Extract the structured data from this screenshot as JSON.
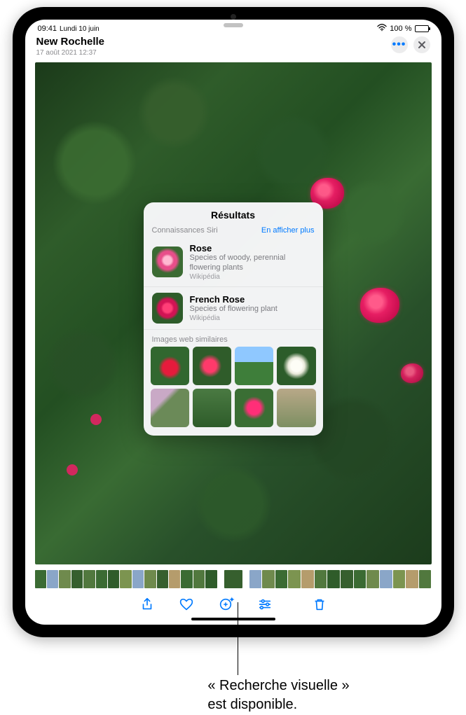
{
  "status": {
    "time": "09:41",
    "date": "Lundi 10 juin",
    "battery_pct": "100 %",
    "wifi_icon": "wifi-icon",
    "battery_icon": "battery-icon"
  },
  "header": {
    "title": "New Rochelle",
    "subtitle": "17 août 2021  12:37",
    "more_icon": "ellipsis-icon",
    "close_icon": "xmark-icon"
  },
  "popover": {
    "title": "Résultats",
    "siri_label": "Connaissances Siri",
    "show_more": "En afficher plus",
    "results": [
      {
        "name": "Rose",
        "desc": "Species of woody, perennial flowering plants",
        "source": "Wikipédia"
      },
      {
        "name": "French Rose",
        "desc": "Species of flowering plant",
        "source": "Wikipédia"
      }
    ],
    "similar_label": "Images web similaires"
  },
  "toolbar": {
    "share": "share-icon",
    "favorite": "heart-icon",
    "lookup": "visual-lookup-icon",
    "edit": "sliders-icon",
    "trash": "trash-icon"
  },
  "callout": {
    "line1": "« Recherche visuelle »",
    "line2": "est disponible."
  }
}
